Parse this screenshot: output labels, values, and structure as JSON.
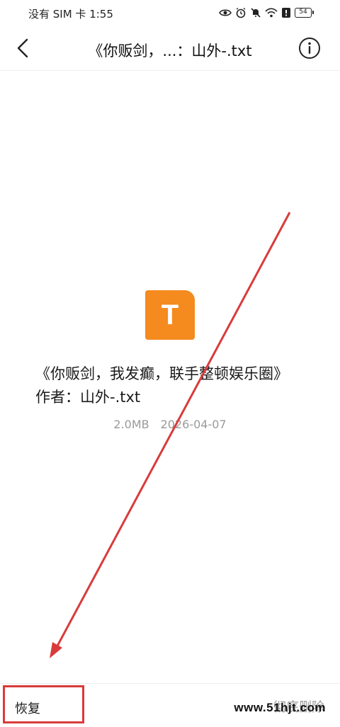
{
  "status_bar": {
    "carrier_time": "没有 SIM 卡 1:55",
    "battery": "54",
    "icons": [
      "eye-icon",
      "alarm-icon",
      "mute-icon",
      "wifi-icon",
      "alert-icon",
      "battery-icon"
    ]
  },
  "header": {
    "title": "《你贩剑，...：山外-.txt"
  },
  "file": {
    "icon_letter": "T",
    "icon_color": "#f58a1f",
    "name": "《你贩剑，我发癫，联手整顿娱乐圈》作者：山外-.txt",
    "size": "2.0MB",
    "date": "2026-04-07"
  },
  "bottom_bar": {
    "restore_label": "恢复",
    "delete_label": "彻底删除"
  },
  "watermark": "www.51hjt.com",
  "colors": {
    "annotation": "#d93b3b",
    "accent": "#f58a1f"
  }
}
